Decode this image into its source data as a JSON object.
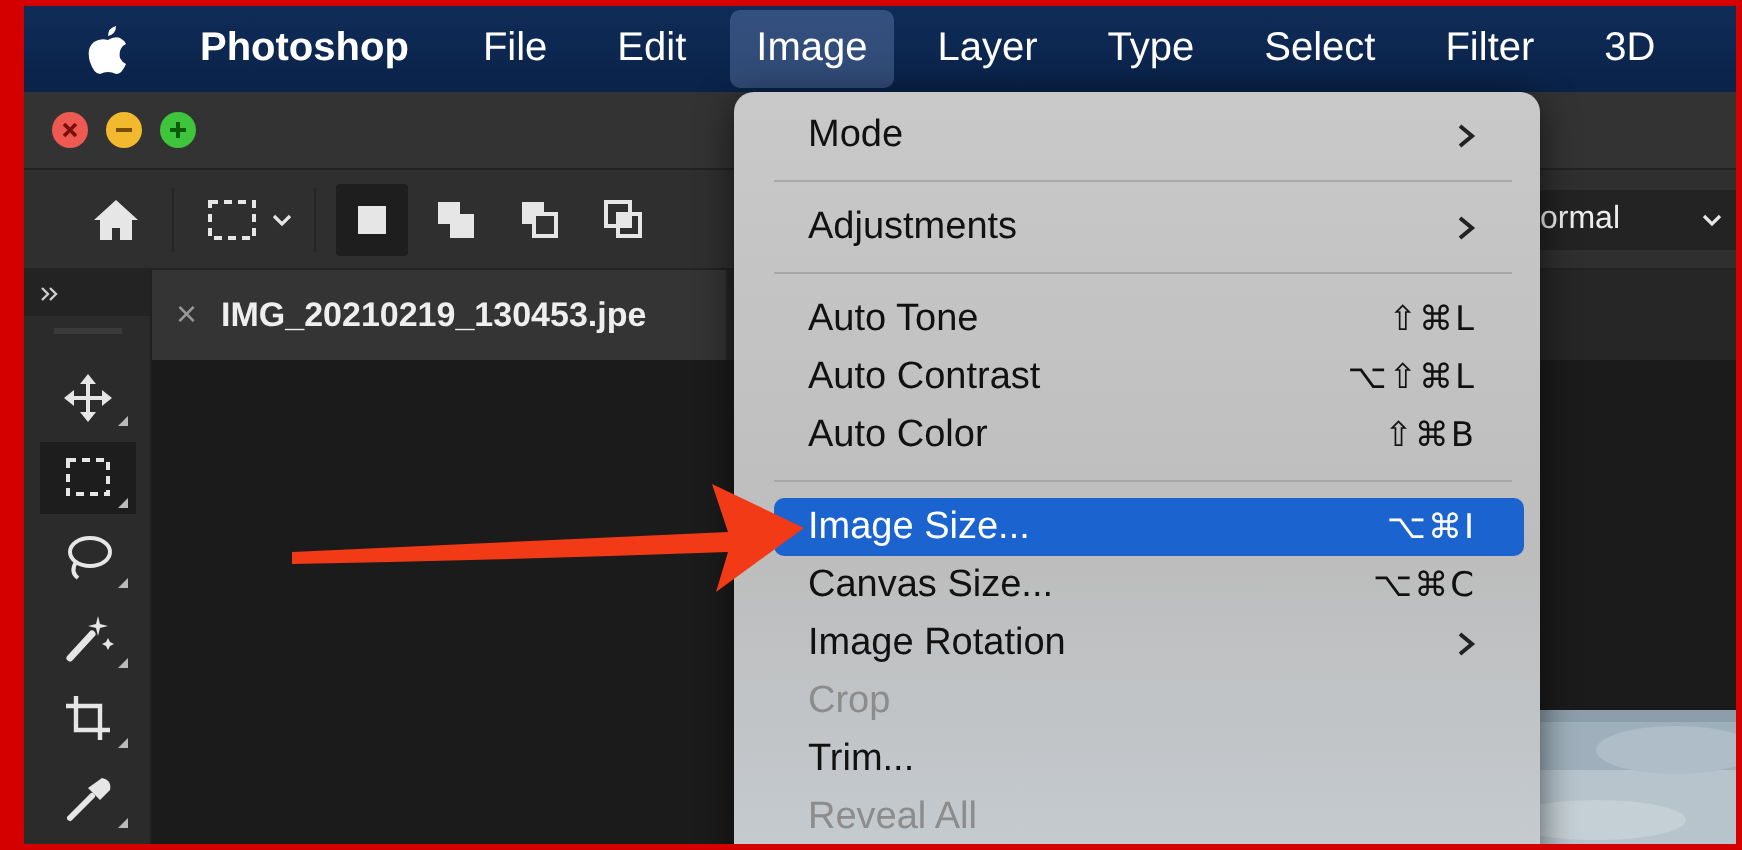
{
  "menu_bar": {
    "app_name": "Photoshop",
    "items": [
      {
        "label": "File",
        "selected": false
      },
      {
        "label": "Edit",
        "selected": false
      },
      {
        "label": "Image",
        "selected": true
      },
      {
        "label": "Layer",
        "selected": false
      },
      {
        "label": "Type",
        "selected": false
      },
      {
        "label": "Select",
        "selected": false
      },
      {
        "label": "Filter",
        "selected": false
      },
      {
        "label": "3D",
        "selected": false
      }
    ]
  },
  "options_bar": {
    "selection_modes": [
      {
        "selected": true
      },
      {
        "selected": false
      },
      {
        "selected": false
      },
      {
        "selected": false
      }
    ],
    "blend_mode": {
      "value": "ormal"
    }
  },
  "toolbar": {
    "tools": [
      {
        "kind": "move",
        "selected": false
      },
      {
        "kind": "marquee",
        "selected": true
      },
      {
        "kind": "lasso",
        "selected": false
      },
      {
        "kind": "wand",
        "selected": false
      },
      {
        "kind": "crop",
        "selected": false
      },
      {
        "kind": "eyedropper",
        "selected": false
      }
    ]
  },
  "document_tab": {
    "close": "×",
    "title": "IMG_20210219_130453.jpe"
  },
  "image_menu": {
    "items": [
      {
        "kind": "item",
        "label": "Mode",
        "submenu": true,
        "selected": false,
        "disabled": false
      },
      {
        "kind": "separator"
      },
      {
        "kind": "item",
        "label": "Adjustments",
        "submenu": true,
        "selected": false,
        "disabled": false
      },
      {
        "kind": "separator"
      },
      {
        "kind": "item",
        "label": "Auto Tone",
        "shortcut": "⇧⌘L",
        "selected": false,
        "disabled": false
      },
      {
        "kind": "item",
        "label": "Auto Contrast",
        "shortcut": "⌥⇧⌘L",
        "selected": false,
        "disabled": false
      },
      {
        "kind": "item",
        "label": "Auto Color",
        "shortcut": "⇧⌘B",
        "selected": false,
        "disabled": false
      },
      {
        "kind": "separator"
      },
      {
        "kind": "item",
        "label": "Image Size...",
        "shortcut": "⌥⌘I",
        "selected": true,
        "disabled": false
      },
      {
        "kind": "item",
        "label": "Canvas Size...",
        "shortcut": "⌥⌘C",
        "selected": false,
        "disabled": false
      },
      {
        "kind": "item",
        "label": "Image Rotation",
        "submenu": true,
        "selected": false,
        "disabled": false
      },
      {
        "kind": "item",
        "label": "Crop",
        "selected": false,
        "disabled": true
      },
      {
        "kind": "item",
        "label": "Trim...",
        "selected": false,
        "disabled": false
      },
      {
        "kind": "item",
        "label": "Reveal All",
        "selected": false,
        "disabled": true
      }
    ]
  }
}
